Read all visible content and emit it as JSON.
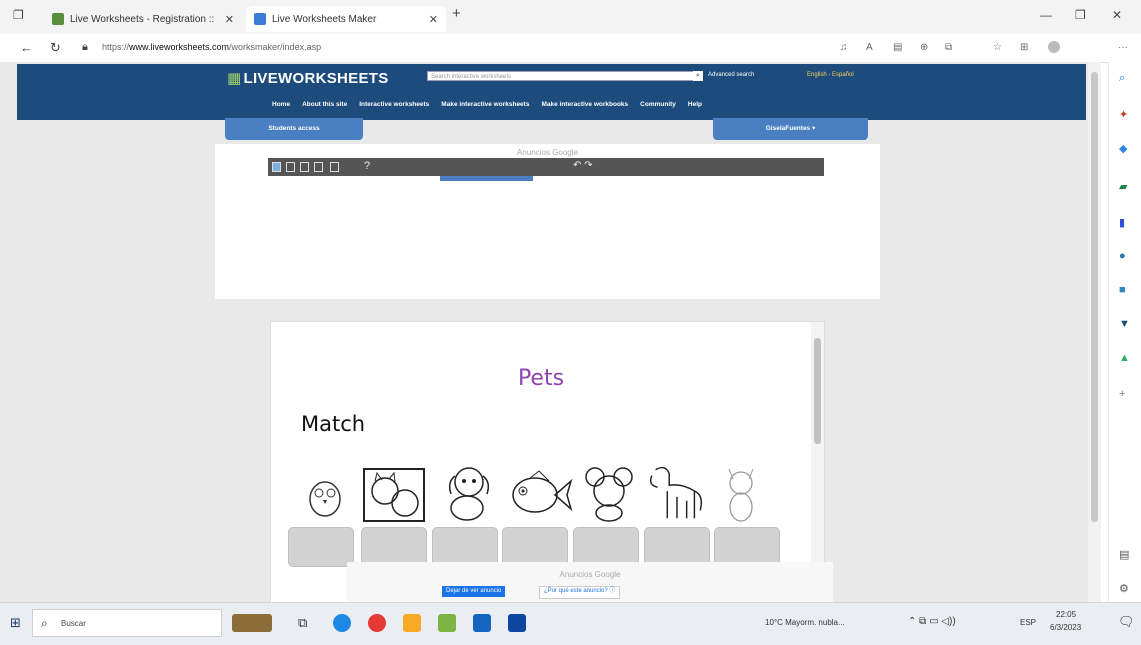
{
  "browser": {
    "tabs": [
      {
        "title": "Live Worksheets - Registration ::"
      },
      {
        "title": "Live Worksheets Maker"
      }
    ],
    "new_tab": "+",
    "url_prefix": "https://",
    "url_host": "www.liveworksheets.com",
    "url_path": "/worksmaker/index.asp"
  },
  "site": {
    "logo_text": "LIVEWORKSHEETS",
    "search_placeholder": "Search interactive worksheets",
    "advanced_search": "Advanced search",
    "language": "English - Español",
    "menu": [
      "Home",
      "About this site",
      "Interactive worksheets",
      "Make interactive worksheets",
      "Make interactive workbooks",
      "Community",
      "Help"
    ],
    "students_access": "Students access",
    "user_menu": "GiselaFuentes ▾"
  },
  "ads": {
    "label": "Anuncios Google",
    "stop_button": "Dejar de ver anuncio",
    "why_button": "¿Por qué este anuncio? ⓘ"
  },
  "editor": {
    "help": "?",
    "undo_redo": "↶ ↷"
  },
  "worksheet": {
    "title": "Pets",
    "instruction": "Match",
    "pets": [
      "bird",
      "cats",
      "dog",
      "fish",
      "mouse",
      "horse",
      "kitten"
    ]
  },
  "taskbar": {
    "search_placeholder": "Buscar",
    "weather": "10°C  Mayorm. nubla...",
    "lang": "ESP",
    "time": "22:05",
    "date": "6/3/2023"
  },
  "colors": {
    "header": "#1d4b7c",
    "accent": "#4a7fc1",
    "title": "#8e44ad"
  }
}
